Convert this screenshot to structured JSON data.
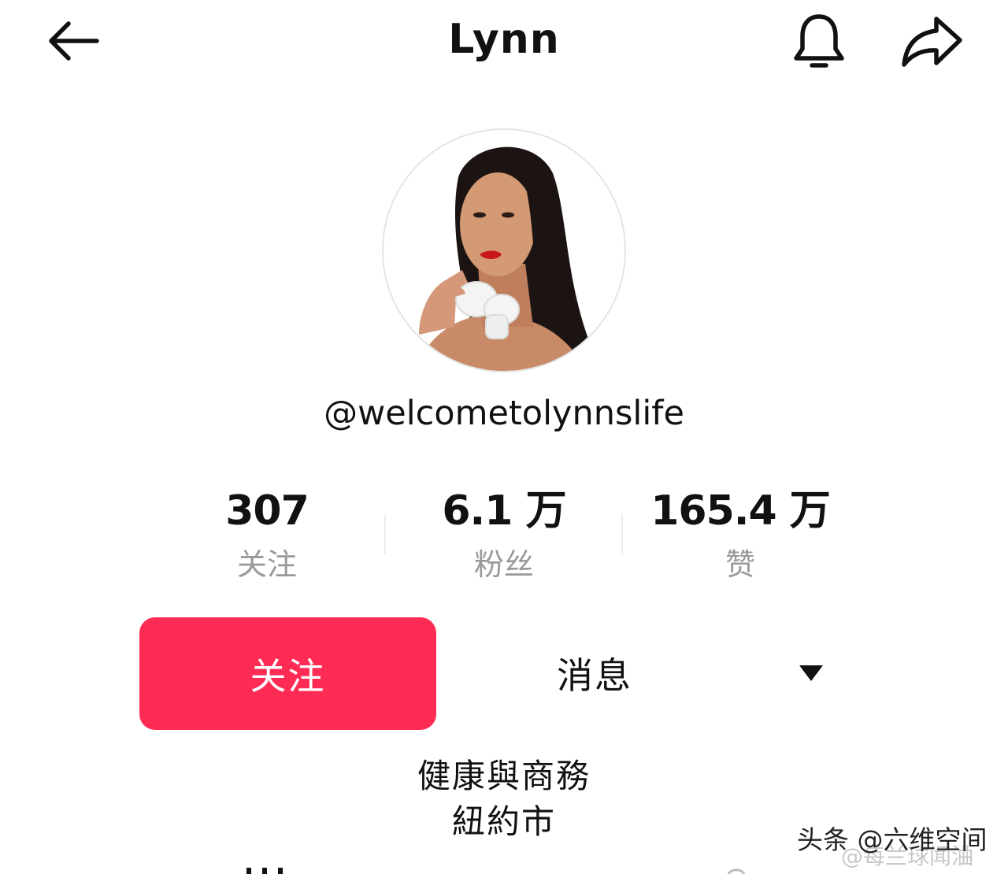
{
  "header": {
    "title": "Lynn",
    "back_icon": "arrow-left-icon",
    "bell_icon": "bell-icon",
    "share_icon": "share-arrow-icon"
  },
  "profile": {
    "handle": "@welcometolynnslife",
    "avatar_description": "profile photo"
  },
  "stats": [
    {
      "value": "307",
      "label": "关注"
    },
    {
      "value": "6.1 万",
      "label": "粉丝"
    },
    {
      "value": "165.4 万",
      "label": "赞"
    }
  ],
  "actions": {
    "follow_label": "关注",
    "message_label": "消息",
    "dropdown_icon": "triangle-down-icon"
  },
  "bio": {
    "line1": "健康與商務",
    "line2": "紐約市"
  },
  "watermark": {
    "text": "头条 @六维空间",
    "faint_text": "@每兰球闻浀"
  },
  "colors": {
    "accent": "#fe2c55",
    "muted_text": "#999999",
    "text": "#111111",
    "background": "#ffffff"
  }
}
